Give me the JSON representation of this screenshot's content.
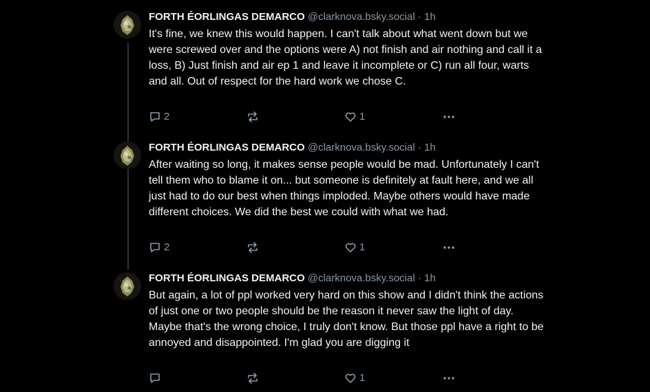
{
  "posts": [
    {
      "author_name": "FORTH ÉORLINGAS DEMARCO",
      "handle": "@clarknova.bsky.social",
      "separator": "·",
      "time": "1h",
      "text": "It's fine, we knew this would happen. I can't talk about what went down but we were screwed over and the options were A) not finish and air nothing and call it a loss, B) Just finish and air ep 1 and leave it incomplete or C) run all four, warts and all. Out of respect for the hard work we chose C.",
      "reply_count": "2",
      "like_count": "1"
    },
    {
      "author_name": "FORTH ÉORLINGAS DEMARCO",
      "handle": "@clarknova.bsky.social",
      "separator": "·",
      "time": "1h",
      "text": "After waiting so long, it makes sense people would be mad. Unfortunately I can't tell them who to blame it on... but someone is definitely at fault here, and we all just had to do our best when things imploded. Maybe others would have made different choices. We did the best we could with what we had.",
      "reply_count": "2",
      "like_count": "1"
    },
    {
      "author_name": "FORTH ÉORLINGAS DEMARCO",
      "handle": "@clarknova.bsky.social",
      "separator": "·",
      "time": "1h",
      "text": "But again, a lot of ppl worked very hard on this show and I didn't think the actions of just one or two people should be the reason it never saw the light of day. Maybe that's the wrong choice, I truly don't know. But those ppl have a right to be annoyed and disappointed. I'm glad you are digging it",
      "reply_count": "",
      "like_count": "1"
    }
  ],
  "icons": {
    "reply": "reply-icon",
    "repost": "repost-icon",
    "like": "heart-icon",
    "more": "more-icon",
    "avatar": "avatar"
  },
  "colors": {
    "background": "#000000",
    "text": "#f1f3f5",
    "muted": "#8b98a5",
    "thread_line": "#2e3338"
  }
}
